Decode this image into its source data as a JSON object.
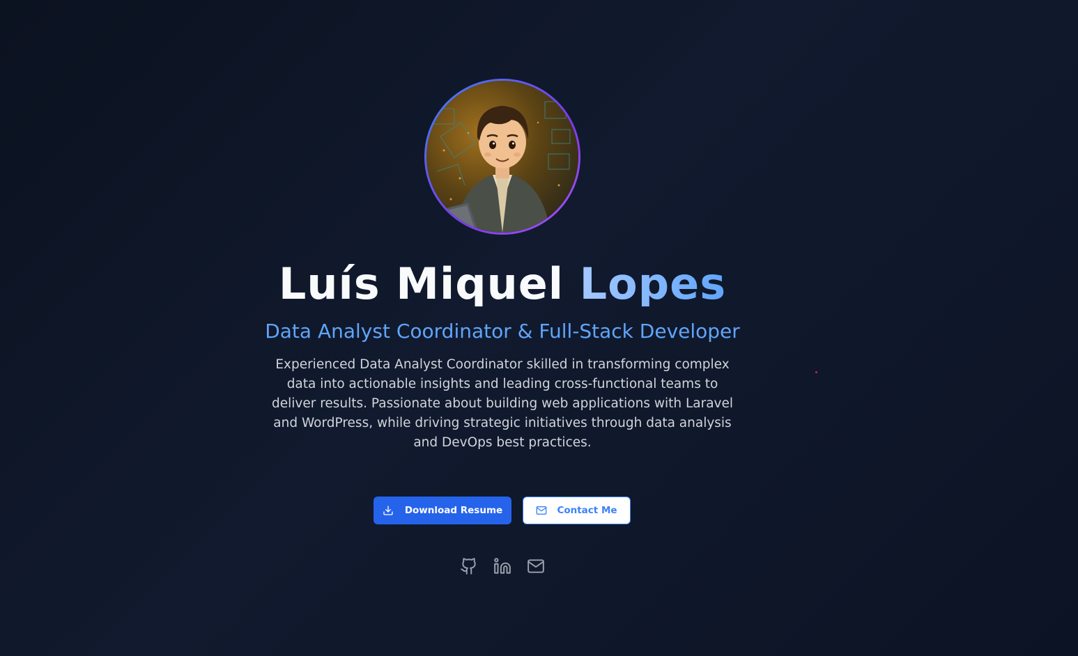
{
  "hero": {
    "avatar_alt": "Luís Miquel Lopes avatar",
    "name_first": "Luís Miquel",
    "name_last": "Lopes",
    "subtitle": "Data Analyst Coordinator & Full-Stack Developer",
    "bio": "Experienced Data Analyst Coordinator skilled in transforming complex data into actionable insights and leading cross-functional teams to deliver results. Passionate about building web applications with Laravel and WordPress, while driving strategic initiatives through data analysis and DevOps best practices."
  },
  "actions": {
    "download_label": "Download Resume",
    "download_icon": "download-icon",
    "contact_label": "Contact Me",
    "contact_icon": "mail-icon"
  },
  "socials": [
    {
      "icon": "github-icon"
    },
    {
      "icon": "linkedin-icon"
    },
    {
      "icon": "mail-icon"
    }
  ],
  "colors": {
    "primary": "#2563eb",
    "accent": "#60a5fa",
    "background": "#0f172a",
    "avatar_ring_start": "#3b82f6",
    "avatar_ring_end": "#a855f7"
  }
}
